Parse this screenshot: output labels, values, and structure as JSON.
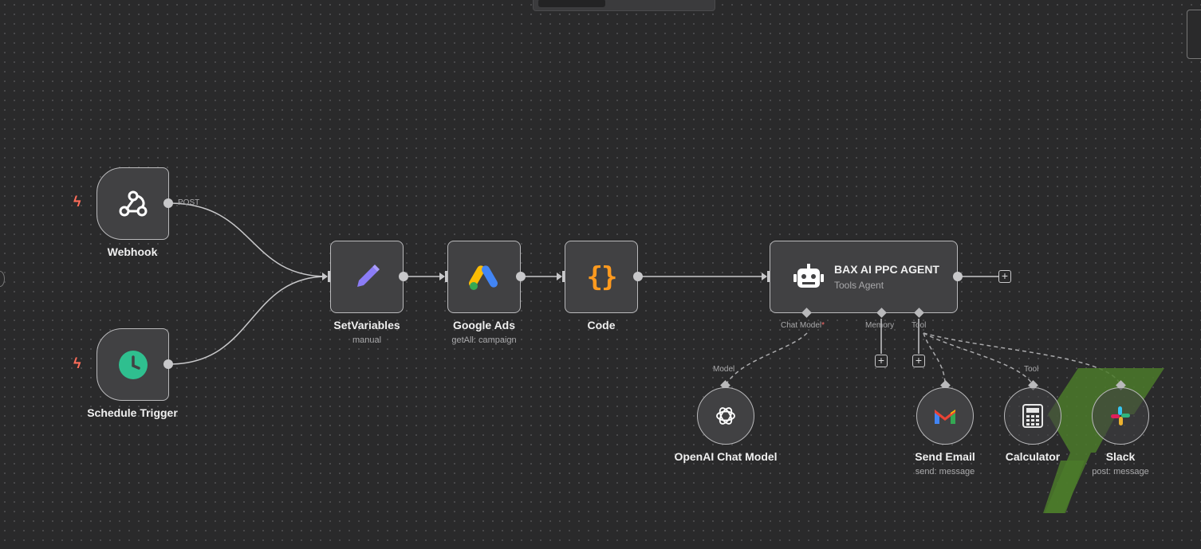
{
  "canvas": {
    "accent": "#ff6d5a",
    "node_bg": "#414143",
    "wire_color": "#c8c8ca"
  },
  "nodes": {
    "webhook": {
      "title": "Webhook",
      "icon": "webhook-icon",
      "output_label": "POST"
    },
    "schedule": {
      "title": "Schedule Trigger",
      "icon": "clock-icon"
    },
    "setvariables": {
      "title": "SetVariables",
      "subtitle": "manual",
      "icon": "pencil-icon"
    },
    "googleads": {
      "title": "Google Ads",
      "subtitle": "getAll: campaign",
      "icon": "google-ads-icon"
    },
    "code": {
      "title": "Code",
      "icon": "code-braces-icon",
      "icon_text": "{}"
    },
    "agent": {
      "title": "BAX AI PPC AGENT",
      "subtitle": "Tools Agent",
      "icon": "robot-icon",
      "inputs": {
        "chat_model": "Chat Model",
        "required_mark": "*",
        "memory": "Memory",
        "tool": "Tool"
      }
    },
    "openai": {
      "title": "OpenAI Chat Model",
      "label": "Model",
      "icon": "openai-icon"
    },
    "sendemail": {
      "title": "Send Email",
      "subtitle": "send: message",
      "icon": "gmail-icon"
    },
    "calculator": {
      "title": "Calculator",
      "label": "Tool",
      "icon": "calculator-icon"
    },
    "slack": {
      "title": "Slack",
      "subtitle": "post: message",
      "icon": "slack-icon"
    }
  }
}
